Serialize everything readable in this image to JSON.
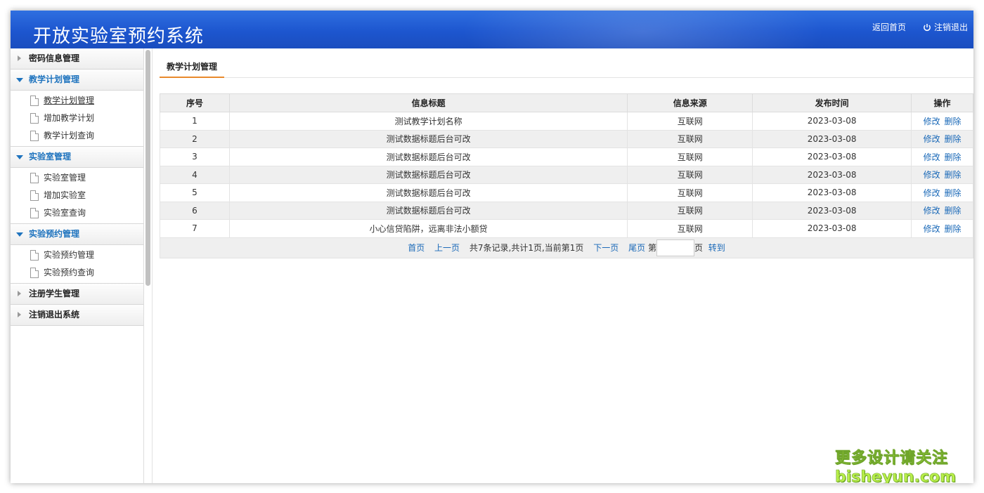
{
  "header": {
    "title": "开放实验室预约系统",
    "home_link": "返回首页",
    "logout_link": "注销退出"
  },
  "sidebar": {
    "groups": [
      {
        "label": "密码信息管理",
        "open": false,
        "items": []
      },
      {
        "label": "教学计划管理",
        "open": true,
        "items": [
          {
            "label": "教学计划管理",
            "active": true
          },
          {
            "label": "增加教学计划"
          },
          {
            "label": "教学计划查询"
          }
        ]
      },
      {
        "label": "实验室管理",
        "open": true,
        "items": [
          {
            "label": "实验室管理"
          },
          {
            "label": "增加实验室"
          },
          {
            "label": "实验室查询"
          }
        ]
      },
      {
        "label": "实验预约管理",
        "open": true,
        "items": [
          {
            "label": "实验预约管理"
          },
          {
            "label": "实验预约查询"
          }
        ]
      },
      {
        "label": "注册学生管理",
        "open": false,
        "items": []
      },
      {
        "label": "注销退出系统",
        "open": false,
        "items": []
      }
    ]
  },
  "main": {
    "tab_label": "教学计划管理",
    "table": {
      "columns": [
        "序号",
        "信息标题",
        "信息来源",
        "发布时间",
        "操作"
      ],
      "rows": [
        {
          "no": "1",
          "title": "测试教学计划名称",
          "source": "互联网",
          "date": "2023-03-08"
        },
        {
          "no": "2",
          "title": "测试数据标题后台可改",
          "source": "互联网",
          "date": "2023-03-08"
        },
        {
          "no": "3",
          "title": "测试数据标题后台可改",
          "source": "互联网",
          "date": "2023-03-08"
        },
        {
          "no": "4",
          "title": "测试数据标题后台可改",
          "source": "互联网",
          "date": "2023-03-08"
        },
        {
          "no": "5",
          "title": "测试数据标题后台可改",
          "source": "互联网",
          "date": "2023-03-08"
        },
        {
          "no": "6",
          "title": "测试数据标题后台可改",
          "source": "互联网",
          "date": "2023-03-08"
        },
        {
          "no": "7",
          "title": "小心信贷陷阱，远离非法小额贷",
          "source": "互联网",
          "date": "2023-03-08"
        }
      ],
      "edit_label": "修改",
      "delete_label": "删除"
    },
    "pager": {
      "first": "首页",
      "prev": "上一页",
      "summary": "共7条记录,共计1页,当前第1页",
      "next": "下一页",
      "last": "尾页",
      "page_prefix": "第",
      "page_suffix": "页",
      "goto": "转到",
      "page_input_value": ""
    }
  },
  "watermark": {
    "line1": "更多设计请关注",
    "line2": "bisheyun.com"
  }
}
